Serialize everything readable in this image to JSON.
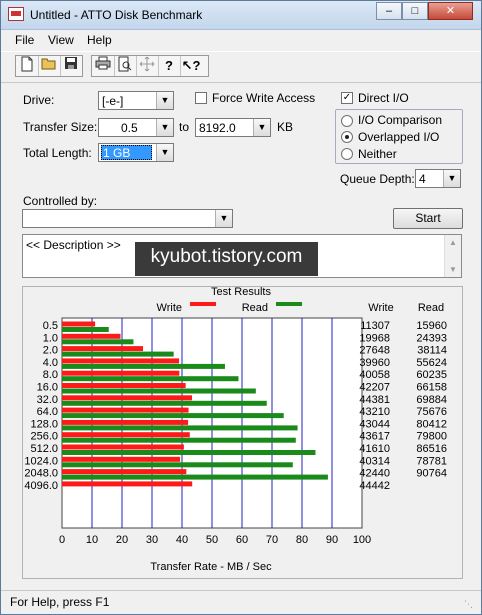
{
  "window": {
    "title": "Untitled - ATTO Disk Benchmark"
  },
  "menu": [
    "File",
    "View",
    "Help"
  ],
  "toolbar_icons": [
    "new-file-icon",
    "open-folder-icon",
    "save-icon",
    "print-icon",
    "print-preview-icon",
    "move-icon",
    "help-icon",
    "context-help-icon"
  ],
  "settings": {
    "drive_label": "Drive:",
    "drive_value": "[-e-]",
    "force_write_label": "Force Write Access",
    "direct_io_label": "Direct I/O",
    "transfer_size_label": "Transfer Size:",
    "transfer_from": "0.5",
    "to_label": "to",
    "transfer_to": "8192.0",
    "unit_label": "KB",
    "total_length_label": "Total Length:",
    "total_length_value": "1 GB",
    "io_comparison_label": "I/O Comparison",
    "overlapped_io_label": "Overlapped I/O",
    "neither_label": "Neither",
    "queue_depth_label": "Queue Depth:",
    "queue_depth_value": "4",
    "controlled_by_label": "Controlled by:",
    "controlled_by_value": "",
    "start_label": "Start",
    "description_text": "<< Description >>"
  },
  "watermark_text": "kyubot.tistory.com",
  "results": {
    "title": "Test Results",
    "write_legend": "Write",
    "read_legend": "Read",
    "write_header": "Write",
    "read_header": "Read",
    "write_color": "#ff1a1a",
    "read_color": "#1a8a1a"
  },
  "chart_data": {
    "type": "bar",
    "orientation": "horizontal",
    "categories": [
      "0.5",
      "1.0",
      "2.0",
      "4.0",
      "8.0",
      "16.0",
      "32.0",
      "64.0",
      "128.0",
      "256.0",
      "512.0",
      "1024.0",
      "2048.0",
      "4096.0"
    ],
    "series": [
      {
        "name": "Write",
        "values": [
          11307,
          19968,
          27648,
          39960,
          40058,
          42207,
          44381,
          43210,
          43044,
          43617,
          41610,
          40314,
          42440,
          44442
        ]
      },
      {
        "name": "Read",
        "values": [
          15960,
          24393,
          38114,
          55624,
          60235,
          66158,
          69884,
          75676,
          80412,
          79800,
          86516,
          78781,
          90764,
          null
        ]
      }
    ],
    "xlabel": "Transfer Rate - MB / Sec",
    "xlim": [
      0,
      100
    ],
    "xticks": [
      0,
      10,
      20,
      30,
      40,
      50,
      60,
      70,
      80,
      90,
      100
    ],
    "grid": true
  },
  "status": {
    "text": "For Help, press F1"
  }
}
